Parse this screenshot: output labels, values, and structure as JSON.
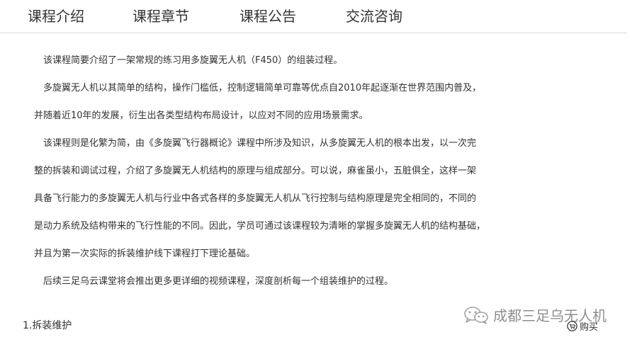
{
  "tabs": [
    {
      "label": "课程介绍"
    },
    {
      "label": "课程章节"
    },
    {
      "label": "课程公告"
    },
    {
      "label": "交流咨询"
    }
  ],
  "content": {
    "paragraphs": [
      "　该课程简要介绍了一架常规的练习用多旋翼无人机（F450）的组装过程。",
      "　多旋翼无人机以其简单的结构，操作门槛低，控制逻辑简单可靠等优点自2010年起逐渐在世界范围内普及，",
      "并随着近10年的发展，衍生出各类型结构布局设计，以应对不同的应用场景需求。",
      "　该课程则是化繁为简，由《多旋翼飞行器概论》课程中所涉及知识，从多旋翼无人机的根本出发，以一次完",
      "整的拆装和调试过程，介绍了多旋翼无人机结构的原理与组成部分。可以说，麻雀虽小，五脏俱全，这样一架",
      "具备飞行能力的多旋翼无人机与行业中各式各样的多旋翼无人机从飞行控制与结构原理是完全相同的，不同的",
      "是动力系统及结构带来的飞行性能的不同。因此，学员可通过该课程较为清晰的掌握多旋翼无人机的结构基础，",
      "并且为第一次实际的拆装维护线下课程打下理论基础。",
      "　后续三足乌云课堂将会推出更多更详细的视频课程，深度剖析每一个组装维护的过程。"
    ]
  },
  "section": {
    "heading": "1.拆装维护"
  },
  "watermark": {
    "text": "成都三足乌无人机",
    "icon": "wechat-icon"
  },
  "buy": {
    "label": "购买",
    "icon": "cart-icon"
  }
}
